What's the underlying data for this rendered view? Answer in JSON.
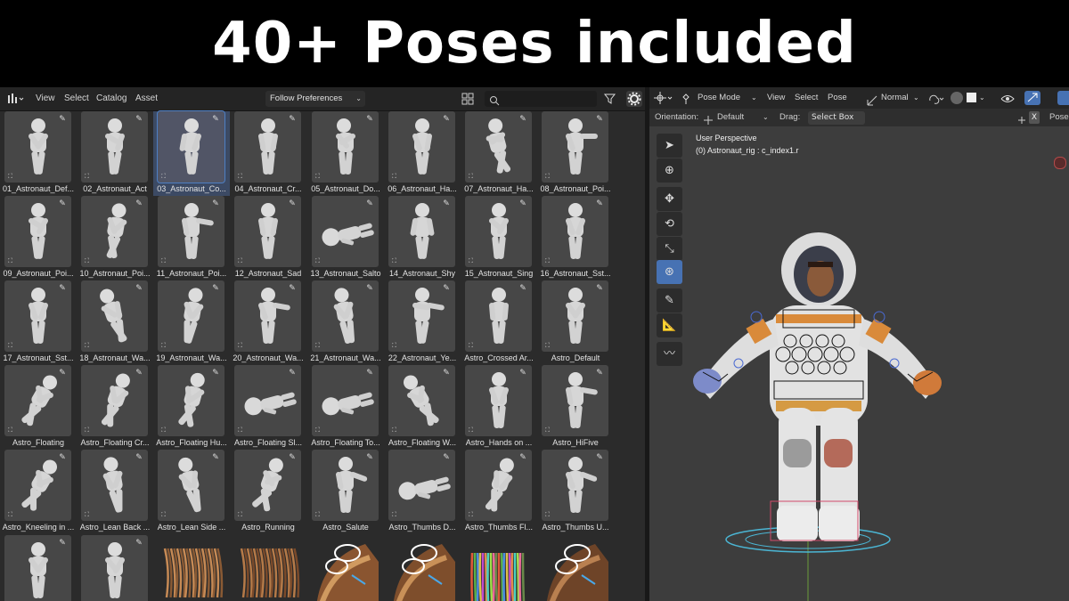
{
  "banner": {
    "title": "40+ Poses included"
  },
  "asset_browser": {
    "menu": {
      "view": "View",
      "select": "Select",
      "catalog": "Catalog",
      "asset": "Asset"
    },
    "library_dropdown": "Follow Preferences",
    "search_placeholder": "",
    "items": [
      "01_Astronaut_Def...",
      "02_Astronaut_Act",
      "03_Astronaut_Co...",
      "04_Astronaut_Cr...",
      "05_Astronaut_Do...",
      "06_Astronaut_Ha...",
      "07_Astronaut_Ha...",
      "08_Astronaut_Poi...",
      "09_Astronaut_Poi...",
      "10_Astronaut_Poi...",
      "11_Astronaut_Poi...",
      "12_Astronaut_Sad",
      "13_Astronaut_Salto",
      "14_Astronaut_Shy",
      "15_Astronaut_Sing",
      "16_Astronaut_Sst...",
      "17_Astronaut_Sst...",
      "18_Astronaut_Wa...",
      "19_Astronaut_Wa...",
      "20_Astronaut_Wa...",
      "21_Astronaut_Wa...",
      "22_Astronaut_Ye...",
      "Astro_Crossed Ar...",
      "Astro_Default",
      "Astro_Floating",
      "Astro_Floating Cr...",
      "Astro_Floating Hu...",
      "Astro_Floating Sl...",
      "Astro_Floating To...",
      "Astro_Floating W...",
      "Astro_Hands on ...",
      "Astro_HiFive",
      "Astro_Kneeling in ...",
      "Astro_Lean Back ...",
      "Astro_Lean Side ...",
      "Astro_Running",
      "Astro_Salute",
      "Astro_Thumbs D...",
      "Astro_Thumbs Fl...",
      "Astro_Thumbs U..."
    ],
    "selected_index": 2
  },
  "viewport": {
    "mode": "Pose Mode",
    "menu": {
      "view": "View",
      "select": "Select",
      "pose": "Pose"
    },
    "transform_orientation": "Normal",
    "orientation_label": "Orientation:",
    "orientation_value": "Default",
    "drag_label": "Drag:",
    "drag_value": "Select Box",
    "pose_tab": "Pose",
    "close_label": "X",
    "perspective": "User Perspective",
    "active_object": "(0) Astronaut_rig : c_index1.r",
    "colors": {
      "accent": "#4772b3",
      "selected_outline": "#4d7fc4"
    }
  }
}
